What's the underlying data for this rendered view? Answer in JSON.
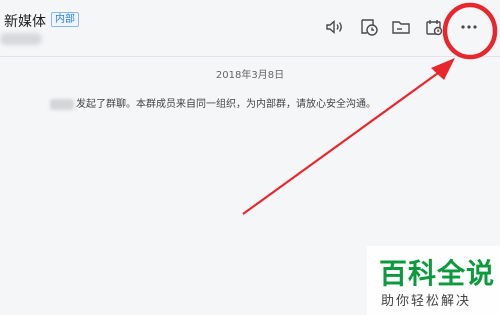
{
  "header": {
    "title": "新媒体",
    "badge": "内部"
  },
  "toolbar": {
    "icons": [
      "speaker-icon",
      "history-icon",
      "folder-icon",
      "calendar-icon",
      "more-icon"
    ]
  },
  "chat": {
    "date": "2018年3月8日",
    "system_message": "发起了群聊。本群成员来自同一组织，为内部群，请放心安全沟通。"
  },
  "annotation": {
    "color": "#e8262b"
  },
  "watermark": {
    "title": "百科全说",
    "subtitle": "助你轻松解决"
  }
}
